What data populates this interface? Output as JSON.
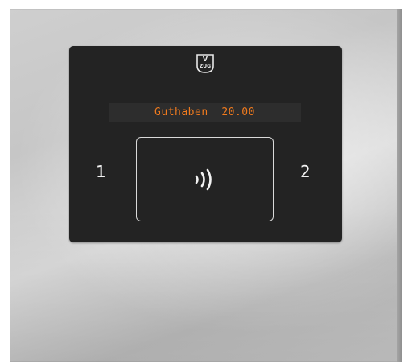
{
  "device": {
    "logo": {
      "top": "V",
      "bottom": "ZUG",
      "icon": "vzug-logo-icon"
    },
    "display": {
      "label": "Guthaben",
      "value": "20.00",
      "text": "Guthaben  20.00",
      "text_color": "#f07a1e"
    },
    "reader": {
      "icon": "contactless-icon"
    },
    "keys": {
      "left": "1",
      "right": "2"
    },
    "colors": {
      "panel": "#232323",
      "housing": "#c8c8c8"
    }
  }
}
